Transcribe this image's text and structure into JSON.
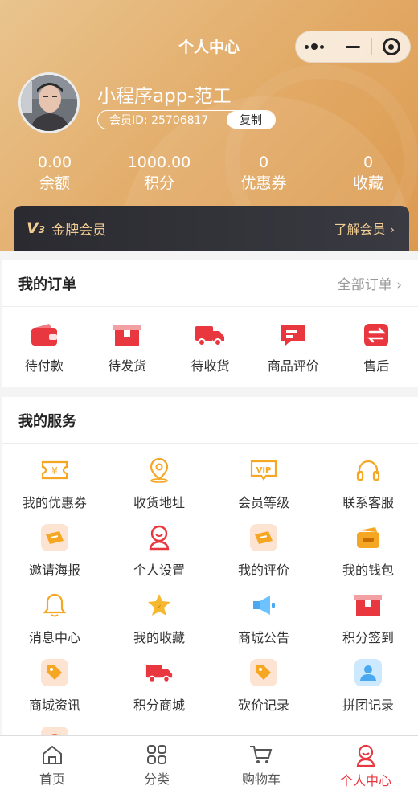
{
  "nav": {
    "title": "个人中心"
  },
  "user": {
    "nickname": "小程序app-范工",
    "member_id": "会员ID: 25706817",
    "copy_label": "复制"
  },
  "stats": [
    {
      "value": "0.00",
      "label": "余额"
    },
    {
      "value": "1000.00",
      "label": "积分"
    },
    {
      "value": "0",
      "label": "优惠券"
    },
    {
      "value": "0",
      "label": "收藏"
    }
  ],
  "vip": {
    "level": "V",
    "level_num": "3",
    "title": "金牌会员",
    "more": "了解会员"
  },
  "orders": {
    "title": "我的订单",
    "more": "全部订单",
    "items": [
      {
        "label": "待付款",
        "icon": "wallet-icon"
      },
      {
        "label": "待发货",
        "icon": "box-icon"
      },
      {
        "label": "待收货",
        "icon": "truck-icon"
      },
      {
        "label": "商品评价",
        "icon": "comment-icon"
      },
      {
        "label": "售后",
        "icon": "exchange-icon"
      }
    ]
  },
  "services": {
    "title": "我的服务",
    "items": [
      {
        "label": "我的优惠券",
        "icon": "coupon-icon"
      },
      {
        "label": "收货地址",
        "icon": "location-icon"
      },
      {
        "label": "会员等级",
        "icon": "vip-icon"
      },
      {
        "label": "联系客服",
        "icon": "headset-icon"
      },
      {
        "label": "邀请海报",
        "icon": "ticket-icon"
      },
      {
        "label": "个人设置",
        "icon": "user-icon"
      },
      {
        "label": "我的评价",
        "icon": "ticket-icon"
      },
      {
        "label": "我的钱包",
        "icon": "wallet-icon"
      },
      {
        "label": "消息中心",
        "icon": "bell-icon"
      },
      {
        "label": "我的收藏",
        "icon": "star-icon"
      },
      {
        "label": "商城公告",
        "icon": "megaphone-icon"
      },
      {
        "label": "积分签到",
        "icon": "box-icon"
      },
      {
        "label": "商城资讯",
        "icon": "tag-icon"
      },
      {
        "label": "积分商城",
        "icon": "truck-icon"
      },
      {
        "label": "砍价记录",
        "icon": "tag-icon"
      },
      {
        "label": "拼团记录",
        "icon": "group-icon"
      }
    ]
  },
  "tabbar": [
    {
      "label": "首页",
      "icon": "home-icon"
    },
    {
      "label": "分类",
      "icon": "grid-icon"
    },
    {
      "label": "购物车",
      "icon": "cart-icon"
    },
    {
      "label": "个人中心",
      "icon": "user-icon",
      "active": true
    }
  ],
  "colors": {
    "primary": "#e8373f",
    "gold": "#e2aa66",
    "service_orange": "#f5a623",
    "vip_text": "#f1cd94"
  }
}
